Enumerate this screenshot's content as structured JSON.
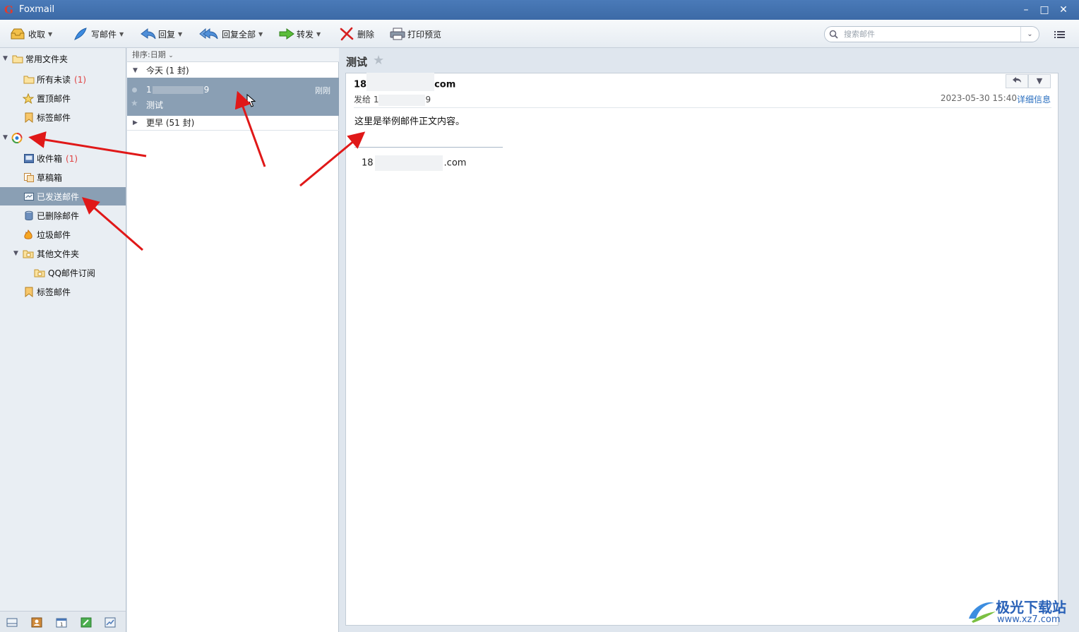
{
  "window": {
    "app_title": "Foxmail"
  },
  "toolbar": {
    "receive": "收取",
    "compose": "写邮件",
    "reply": "回复",
    "reply_all": "回复全部",
    "forward": "转发",
    "delete": "删除",
    "print_preview": "打印预览",
    "search_placeholder": "搜索邮件"
  },
  "sidebar": {
    "common_folders": "常用文件夹",
    "all_unread": "所有未读",
    "all_unread_count": "(1)",
    "pinned": "置顶邮件",
    "tagged": "标签邮件",
    "inbox": "收件箱",
    "inbox_count": "(1)",
    "drafts": "草稿箱",
    "sent": "已发送邮件",
    "deleted": "已删除邮件",
    "junk": "垃圾邮件",
    "other_folders": "其他文件夹",
    "qq_subscription": "QQ邮件订阅",
    "tagged2": "标签邮件"
  },
  "list": {
    "sort_label": "排序:日期",
    "group_today": "今天 (1 封)",
    "group_earlier": "更早 (51 封)",
    "message": {
      "from_start": "1",
      "from_end": "9",
      "subject": "测试",
      "time": "刚刚"
    }
  },
  "reader": {
    "subject": "测试",
    "sender_start": "18",
    "sender_end": "com",
    "to_label": "发给 1",
    "to_end": "9",
    "date": "2023-05-30 15:40",
    "detail_link": "详细信息",
    "body": "这里是举例邮件正文内容。",
    "signature_start": "18",
    "signature_end": ".com"
  },
  "watermark": {
    "line1": "极光下载站",
    "line2": "www.xz7.com"
  },
  "colors": {
    "accent": "#3c6aa6",
    "selected": "#8a9fb4",
    "annotation": "#e01818",
    "unread": "#e04040"
  }
}
